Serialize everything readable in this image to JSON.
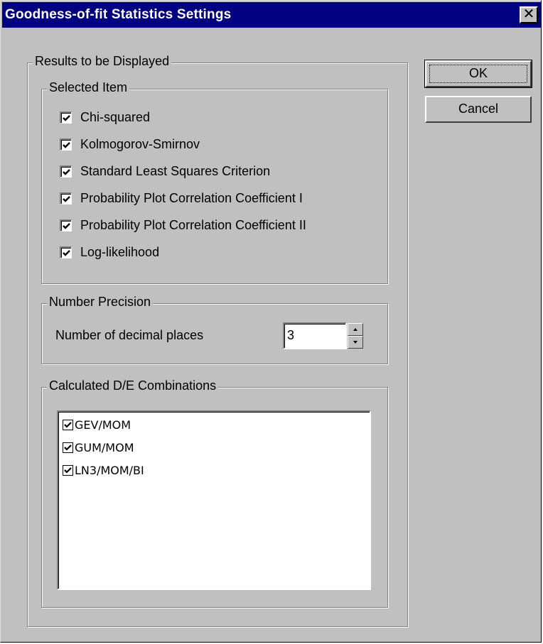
{
  "window": {
    "title": "Goodness-of-fit Statistics Settings",
    "close_glyph": "✕"
  },
  "buttons": {
    "ok": "OK",
    "cancel": "Cancel"
  },
  "results_group": {
    "label": "Results to be Displayed"
  },
  "selected_item": {
    "label": "Selected Item",
    "items": [
      {
        "label": "Chi-squared",
        "checked": true
      },
      {
        "label": "Kolmogorov-Smirnov",
        "checked": true
      },
      {
        "label": "Standard Least Squares Criterion",
        "checked": true
      },
      {
        "label": "Probability Plot Correlation Coefficient I",
        "checked": true
      },
      {
        "label": "Probability Plot Correlation Coefficient II",
        "checked": true
      },
      {
        "label": "Log-likelihood",
        "checked": true
      }
    ]
  },
  "number_precision": {
    "label": "Number Precision",
    "field_label": "Number of decimal places",
    "value": "3"
  },
  "combinations": {
    "label": "Calculated D/E Combinations",
    "items": [
      {
        "label": "GEV/MOM",
        "checked": true
      },
      {
        "label": "GUM/MOM",
        "checked": true
      },
      {
        "label": "LN3/MOM/BI",
        "checked": true
      }
    ]
  },
  "icons": {
    "close": "close-icon",
    "check": "checkmark-icon",
    "spin_up": "arrow-up-icon",
    "spin_down": "arrow-down-icon"
  }
}
